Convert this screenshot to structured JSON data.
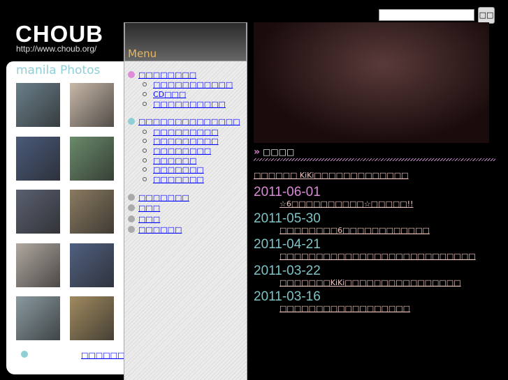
{
  "header": {
    "logo": "CHOUB",
    "url": "http://www.choub.org/"
  },
  "search": {
    "value": "",
    "button": "□□"
  },
  "sidebar": {
    "title": "manila Photos",
    "more_link": "□□□□□□□",
    "photo_count": 10
  },
  "menu": {
    "title": "Menu",
    "groups": [
      {
        "label": "□□□□□□□□",
        "color": "#e08ad8",
        "items": [
          "□□□□□□□□□□□",
          "CD□□□",
          "□□□□□□□□□□"
        ]
      },
      {
        "label": "□□□□□□□□□□□□□□",
        "color": "#8fcfd6",
        "items": [
          "□□□□□□□□□",
          "□□□□□□□□□",
          "□□□□□□□□",
          "□□□□□□",
          "□□□□□□□",
          "□□□□□□□"
        ]
      },
      {
        "label": "□□□□□□□",
        "color": "#aaaaaa",
        "items": []
      },
      {
        "label": "□□□",
        "color": "#aaaaaa",
        "items": []
      },
      {
        "label": "□□□",
        "color": "#aaaaaa",
        "items": []
      },
      {
        "label": "□□□□□□",
        "color": "#aaaaaa",
        "items": []
      }
    ]
  },
  "news": {
    "heading": "□□□□",
    "top_link": "□□□□□□ KiKi□□□□□□□□□□□□□",
    "entries": [
      {
        "date": "2011-06-01",
        "title": "☆6□□□□□□□□□□☆□□□□□!!",
        "color": "#d98ad6"
      },
      {
        "date": "2011-05-30",
        "title": "□□□□□□□□6□□□□□□□□□□□□",
        "color": "#7fc3c6"
      },
      {
        "date": "2011-04-21",
        "title": "□□□□□□□□□□□□□□□□□□□□□□□□□□□",
        "color": "#7fc3c6"
      },
      {
        "date": "2011-03-22",
        "title": "□□□□□□□KiKi□□□□□□□□□□□□□□□□",
        "color": "#7fc3c6"
      },
      {
        "date": "2011-03-16",
        "title": "□□□□□□□□□□□□□□□□□□",
        "color": "#7fc3c6"
      }
    ]
  }
}
